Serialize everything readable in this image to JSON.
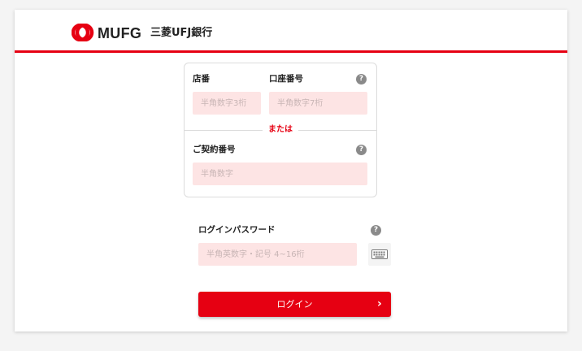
{
  "header": {
    "logo_text": "MUFG",
    "bank_name": "三菱UFJ銀行"
  },
  "branch_account": {
    "branch_label": "店番",
    "branch_placeholder": "半角数字3桁",
    "account_label": "口座番号",
    "account_placeholder": "半角数字7桁"
  },
  "or_label": "または",
  "contract": {
    "label": "ご契約番号",
    "placeholder": "半角数字"
  },
  "password": {
    "label": "ログインパスワード",
    "placeholder": "半角英数字・記号 4~16桁"
  },
  "help_glyph": "?",
  "login_button": {
    "label": "ログイン",
    "chevron": "›"
  },
  "colors": {
    "brand_red": "#e60012",
    "input_bg": "#fde4e4"
  },
  "icons": [
    "mufg-logo-icon",
    "help-icon",
    "keyboard-icon",
    "chevron-right-icon"
  ]
}
